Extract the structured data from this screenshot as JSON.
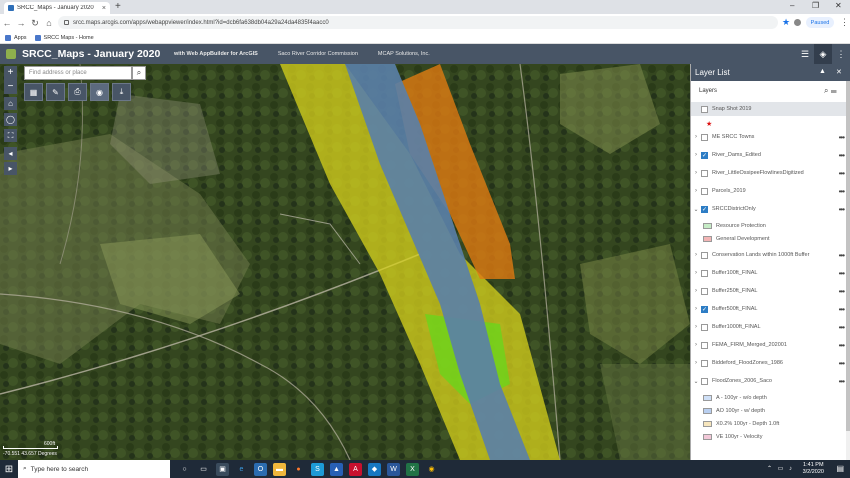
{
  "browser": {
    "tab_title": "SRCC_Maps - January 2020",
    "url": "srcc.maps.arcgis.com/apps/webappviewer/index.html?id=dcb6fa638db04a29a24da4835f4aacc0",
    "profile": "Paused",
    "bookmarks": [
      "Apps",
      "SRCC Maps - Home"
    ]
  },
  "app": {
    "title": "SRCC_Maps - January 2020",
    "builder_text": "with Web AppBuilder for ArcGIS",
    "org1": "Saco River Corridor Commission",
    "org2": "MCAP Solutions, Inc."
  },
  "map": {
    "search_placeholder": "Find address or place",
    "coords": "-70.551 43.657 Degrees",
    "scale_label": "600ft",
    "zoom_in": "+",
    "zoom_out": "−",
    "icons": [
      "home-icon",
      "locate-icon",
      "fullscreen-icon",
      "back-icon",
      "forward-icon"
    ],
    "widgets": [
      "basemap-gallery-icon",
      "draw-icon",
      "print-icon",
      "layer-visibility-icon",
      "measure-icon"
    ]
  },
  "panel": {
    "title": "Layer List",
    "layers_label": "Layers",
    "rows": [
      {
        "label": "Snap Shot 2019",
        "checked": false,
        "expand": "",
        "highlight": true
      },
      {
        "label": "ME SRCC Towns",
        "checked": false,
        "expand": "›"
      },
      {
        "label": "River_Dams_Edited",
        "checked": true,
        "expand": "›"
      },
      {
        "label": "River_LittleOssipeeFlowlinesDigitized",
        "checked": false,
        "expand": "›"
      },
      {
        "label": "Parcels_2019",
        "checked": false,
        "expand": "›"
      },
      {
        "label": "SRCCDistrictOnly",
        "checked": true,
        "expand": "⌄"
      },
      {
        "label": "Conservation Lands within 1000ft Buffer",
        "checked": false,
        "expand": "›"
      },
      {
        "label": "Buffer100ft_FINAL",
        "checked": false,
        "expand": "›"
      },
      {
        "label": "Buffer250ft_FINAL",
        "checked": false,
        "expand": "›"
      },
      {
        "label": "Buffer500ft_FINAL",
        "checked": true,
        "expand": "›"
      },
      {
        "label": "Buffer1000ft_FINAL",
        "checked": false,
        "expand": "›"
      },
      {
        "label": "FEMA_FIRM_Merged_202001",
        "checked": false,
        "expand": "›"
      },
      {
        "label": "Biddeford_FloodZones_1986",
        "checked": false,
        "expand": "›"
      },
      {
        "label": "FloodZones_2006_Saco",
        "checked": false,
        "expand": "⌄"
      }
    ],
    "district_legend": [
      {
        "label": "Resource Protection",
        "color": "#c6ecc6"
      },
      {
        "label": "General Development",
        "color": "#f3b5b5"
      }
    ],
    "flood_legend": [
      {
        "label": "A - 100yr - w/o depth",
        "color": "#cfe0f7"
      },
      {
        "label": "AO 100yr - w/ depth",
        "color": "#b9cff0"
      },
      {
        "label": "X0.2% 100yr - Depth 1.0ft",
        "color": "#f7e6bd"
      },
      {
        "label": "VE 100yr - Velocity",
        "color": "#f2c8d8"
      }
    ]
  },
  "taskbar": {
    "search_text": "Type here to search",
    "time": "1:41 PM",
    "date": "3/2/2020"
  }
}
